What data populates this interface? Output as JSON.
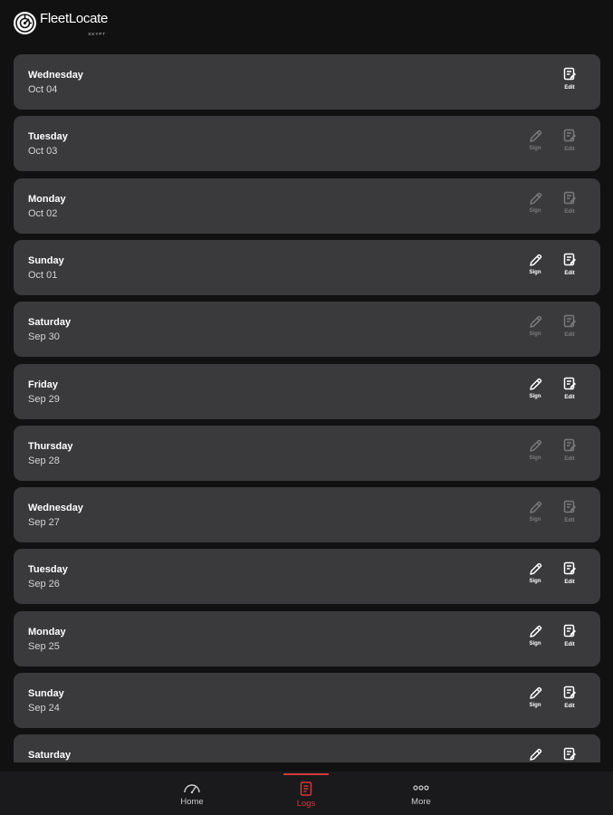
{
  "app": {
    "logo_text": "FleetLocate",
    "logo_sub": "SKYPT",
    "colors": {
      "background": "#121112",
      "card": "#3a393b",
      "accent": "#d23a3a"
    }
  },
  "logs": [
    {
      "day": "Wednesday",
      "date": "Oct 04",
      "sign": "none",
      "edit": "enabled"
    },
    {
      "day": "Tuesday",
      "date": "Oct 03",
      "sign": "disabled",
      "edit": "disabled"
    },
    {
      "day": "Monday",
      "date": "Oct 02",
      "sign": "disabled",
      "edit": "disabled"
    },
    {
      "day": "Sunday",
      "date": "Oct 01",
      "sign": "enabled",
      "edit": "enabled"
    },
    {
      "day": "Saturday",
      "date": "Sep 30",
      "sign": "disabled",
      "edit": "disabled"
    },
    {
      "day": "Friday",
      "date": "Sep 29",
      "sign": "enabled",
      "edit": "enabled"
    },
    {
      "day": "Thursday",
      "date": "Sep 28",
      "sign": "disabled",
      "edit": "disabled"
    },
    {
      "day": "Wednesday",
      "date": "Sep 27",
      "sign": "disabled",
      "edit": "disabled"
    },
    {
      "day": "Tuesday",
      "date": "Sep 26",
      "sign": "enabled",
      "edit": "enabled"
    },
    {
      "day": "Monday",
      "date": "Sep 25",
      "sign": "enabled",
      "edit": "enabled"
    },
    {
      "day": "Sunday",
      "date": "Sep 24",
      "sign": "enabled",
      "edit": "enabled"
    },
    {
      "day": "Saturday",
      "date": "",
      "sign": "enabled",
      "edit": "enabled"
    }
  ],
  "actions": {
    "sign_label": "Sign",
    "edit_label": "Edit",
    "sign_icon": "pencil-icon",
    "edit_icon": "edit-log-icon"
  },
  "tabbar": {
    "tabs": [
      {
        "key": "home",
        "label": "Home",
        "icon": "speedometer-icon",
        "active": false
      },
      {
        "key": "logs",
        "label": "Logs",
        "icon": "logbook-icon",
        "active": true
      },
      {
        "key": "more",
        "label": "More",
        "icon": "more-dots-icon",
        "active": false
      }
    ]
  }
}
